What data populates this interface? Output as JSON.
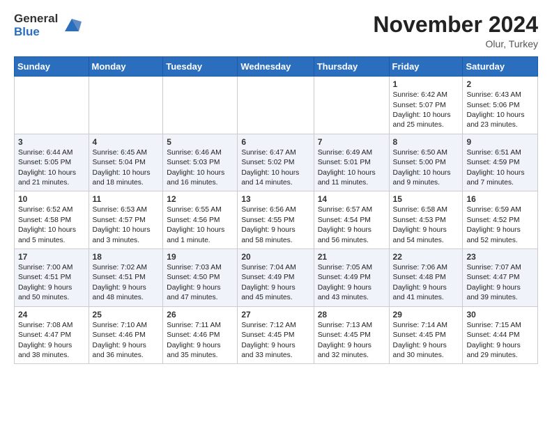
{
  "header": {
    "logo_general": "General",
    "logo_blue": "Blue",
    "month_title": "November 2024",
    "location": "Olur, Turkey"
  },
  "calendar": {
    "days_of_week": [
      "Sunday",
      "Monday",
      "Tuesday",
      "Wednesday",
      "Thursday",
      "Friday",
      "Saturday"
    ],
    "weeks": [
      [
        {
          "day": "",
          "info": ""
        },
        {
          "day": "",
          "info": ""
        },
        {
          "day": "",
          "info": ""
        },
        {
          "day": "",
          "info": ""
        },
        {
          "day": "",
          "info": ""
        },
        {
          "day": "1",
          "info": "Sunrise: 6:42 AM\nSunset: 5:07 PM\nDaylight: 10 hours\nand 25 minutes."
        },
        {
          "day": "2",
          "info": "Sunrise: 6:43 AM\nSunset: 5:06 PM\nDaylight: 10 hours\nand 23 minutes."
        }
      ],
      [
        {
          "day": "3",
          "info": "Sunrise: 6:44 AM\nSunset: 5:05 PM\nDaylight: 10 hours\nand 21 minutes."
        },
        {
          "day": "4",
          "info": "Sunrise: 6:45 AM\nSunset: 5:04 PM\nDaylight: 10 hours\nand 18 minutes."
        },
        {
          "day": "5",
          "info": "Sunrise: 6:46 AM\nSunset: 5:03 PM\nDaylight: 10 hours\nand 16 minutes."
        },
        {
          "day": "6",
          "info": "Sunrise: 6:47 AM\nSunset: 5:02 PM\nDaylight: 10 hours\nand 14 minutes."
        },
        {
          "day": "7",
          "info": "Sunrise: 6:49 AM\nSunset: 5:01 PM\nDaylight: 10 hours\nand 11 minutes."
        },
        {
          "day": "8",
          "info": "Sunrise: 6:50 AM\nSunset: 5:00 PM\nDaylight: 10 hours\nand 9 minutes."
        },
        {
          "day": "9",
          "info": "Sunrise: 6:51 AM\nSunset: 4:59 PM\nDaylight: 10 hours\nand 7 minutes."
        }
      ],
      [
        {
          "day": "10",
          "info": "Sunrise: 6:52 AM\nSunset: 4:58 PM\nDaylight: 10 hours\nand 5 minutes."
        },
        {
          "day": "11",
          "info": "Sunrise: 6:53 AM\nSunset: 4:57 PM\nDaylight: 10 hours\nand 3 minutes."
        },
        {
          "day": "12",
          "info": "Sunrise: 6:55 AM\nSunset: 4:56 PM\nDaylight: 10 hours\nand 1 minute."
        },
        {
          "day": "13",
          "info": "Sunrise: 6:56 AM\nSunset: 4:55 PM\nDaylight: 9 hours\nand 58 minutes."
        },
        {
          "day": "14",
          "info": "Sunrise: 6:57 AM\nSunset: 4:54 PM\nDaylight: 9 hours\nand 56 minutes."
        },
        {
          "day": "15",
          "info": "Sunrise: 6:58 AM\nSunset: 4:53 PM\nDaylight: 9 hours\nand 54 minutes."
        },
        {
          "day": "16",
          "info": "Sunrise: 6:59 AM\nSunset: 4:52 PM\nDaylight: 9 hours\nand 52 minutes."
        }
      ],
      [
        {
          "day": "17",
          "info": "Sunrise: 7:00 AM\nSunset: 4:51 PM\nDaylight: 9 hours\nand 50 minutes."
        },
        {
          "day": "18",
          "info": "Sunrise: 7:02 AM\nSunset: 4:51 PM\nDaylight: 9 hours\nand 48 minutes."
        },
        {
          "day": "19",
          "info": "Sunrise: 7:03 AM\nSunset: 4:50 PM\nDaylight: 9 hours\nand 47 minutes."
        },
        {
          "day": "20",
          "info": "Sunrise: 7:04 AM\nSunset: 4:49 PM\nDaylight: 9 hours\nand 45 minutes."
        },
        {
          "day": "21",
          "info": "Sunrise: 7:05 AM\nSunset: 4:49 PM\nDaylight: 9 hours\nand 43 minutes."
        },
        {
          "day": "22",
          "info": "Sunrise: 7:06 AM\nSunset: 4:48 PM\nDaylight: 9 hours\nand 41 minutes."
        },
        {
          "day": "23",
          "info": "Sunrise: 7:07 AM\nSunset: 4:47 PM\nDaylight: 9 hours\nand 39 minutes."
        }
      ],
      [
        {
          "day": "24",
          "info": "Sunrise: 7:08 AM\nSunset: 4:47 PM\nDaylight: 9 hours\nand 38 minutes."
        },
        {
          "day": "25",
          "info": "Sunrise: 7:10 AM\nSunset: 4:46 PM\nDaylight: 9 hours\nand 36 minutes."
        },
        {
          "day": "26",
          "info": "Sunrise: 7:11 AM\nSunset: 4:46 PM\nDaylight: 9 hours\nand 35 minutes."
        },
        {
          "day": "27",
          "info": "Sunrise: 7:12 AM\nSunset: 4:45 PM\nDaylight: 9 hours\nand 33 minutes."
        },
        {
          "day": "28",
          "info": "Sunrise: 7:13 AM\nSunset: 4:45 PM\nDaylight: 9 hours\nand 32 minutes."
        },
        {
          "day": "29",
          "info": "Sunrise: 7:14 AM\nSunset: 4:45 PM\nDaylight: 9 hours\nand 30 minutes."
        },
        {
          "day": "30",
          "info": "Sunrise: 7:15 AM\nSunset: 4:44 PM\nDaylight: 9 hours\nand 29 minutes."
        }
      ]
    ]
  }
}
